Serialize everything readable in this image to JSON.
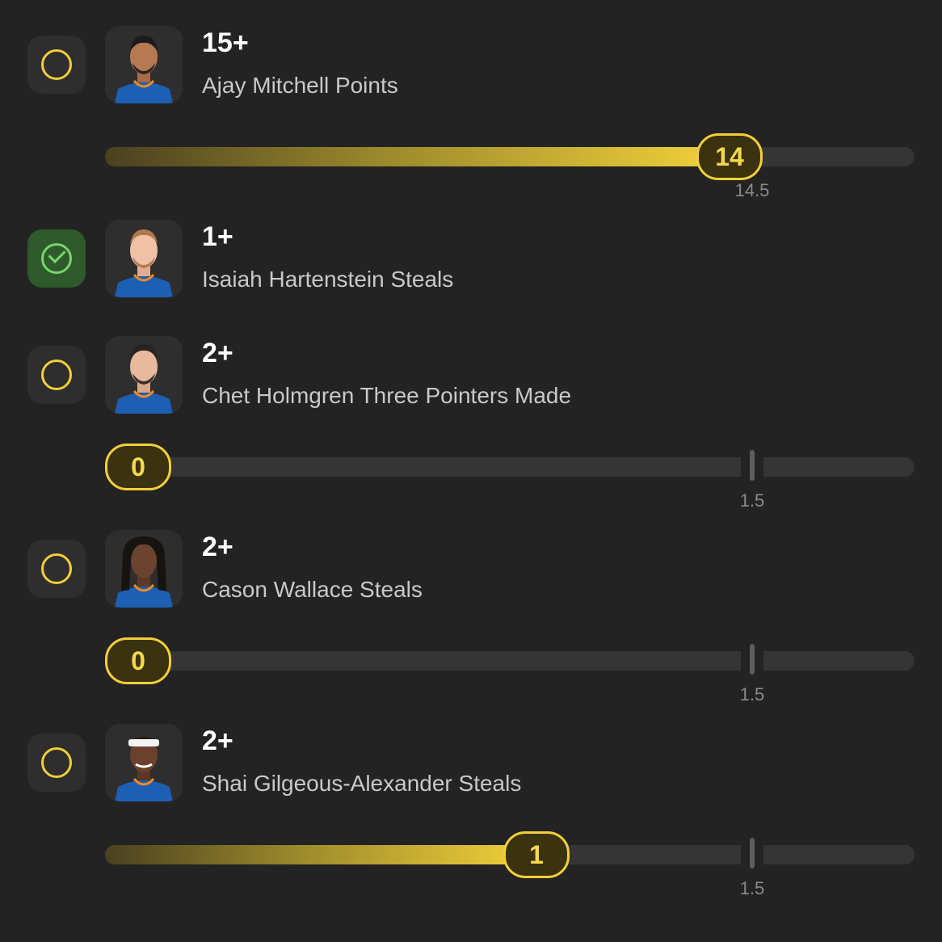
{
  "props": [
    {
      "line": "15+",
      "market": "Ajay Mitchell Points",
      "status": "pending",
      "progress": {
        "current": "14",
        "threshold": "14.5",
        "percent": 77
      }
    },
    {
      "line": "1+",
      "market": "Isaiah Hartenstein Steals",
      "status": "hit"
    },
    {
      "line": "2+",
      "market": "Chet Holmgren Three Pointers Made",
      "status": "pending",
      "progress": {
        "current": "0",
        "threshold": "1.5",
        "percent": 0
      }
    },
    {
      "line": "2+",
      "market": "Cason Wallace Steals",
      "status": "pending",
      "progress": {
        "current": "0",
        "threshold": "1.5",
        "percent": 0
      }
    },
    {
      "line": "2+",
      "market": "Shai Gilgeous-Alexander Steals",
      "status": "pending",
      "progress": {
        "current": "1",
        "threshold": "1.5",
        "percent": 52
      }
    }
  ],
  "colors": {
    "background": "#232323",
    "accent": "#f2cf3a",
    "hit": "#77d66b",
    "track": "#353535"
  },
  "icons": {
    "pending": "empty-circle-icon",
    "hit": "check-circle-icon"
  }
}
